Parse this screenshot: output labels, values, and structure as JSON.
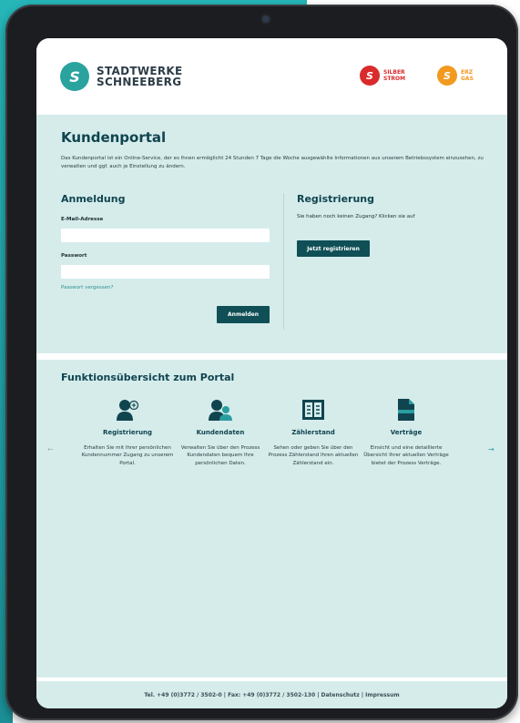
{
  "header": {
    "brand_line1": "STADTWERKE",
    "brand_line2": "SCHNEEBERG",
    "sub_brands": [
      {
        "line1": "SILBER",
        "line2": "STROM",
        "color": "#d92b2b"
      },
      {
        "line1": "ERZ",
        "line2": "GAS",
        "color": "#f29a1f"
      }
    ]
  },
  "portal": {
    "title": "Kundenportal",
    "intro": "Das Kundenportal ist ein Online-Service, der es Ihnen ermöglicht 24 Stunden 7 Tage die Woche ausgewählte Informationen aus unserem Betriebssystem einzusehen, zu verwalten und ggf. auch je Einstellung zu ändern."
  },
  "login": {
    "title": "Anmeldung",
    "email_label": "E-Mail-Adresse",
    "email_value": "",
    "password_label": "Passwort",
    "password_value": "",
    "forgot_link": "Passwort vergessen?",
    "submit_label": "Anmelden"
  },
  "register": {
    "title": "Registrierung",
    "text": "Sie haben noch keinen Zugang? Klicken sie auf",
    "button_label": "Jetzt registrieren"
  },
  "features": {
    "title": "Funktionsübersicht zum Portal",
    "items": [
      {
        "icon": "user-add-icon",
        "name": "Registrierung",
        "desc": "Erhalten Sie mit Ihrer persönlichen Kundennummer Zugang zu unserem Portal."
      },
      {
        "icon": "users-icon",
        "name": "Kundendaten",
        "desc": "Verwalten Sie über den Prozess Kundendaten bequem Ihre persönlichen Daten."
      },
      {
        "icon": "meter-icon",
        "name": "Zählerstand",
        "desc": "Sehen oder geben Sie über den Prozess Zählerstand Ihren aktuellen Zählerstand ein."
      },
      {
        "icon": "document-icon",
        "name": "Verträge",
        "desc": "Einsicht und eine detaillierte Übersicht Ihrer aktuellen Verträge bietet der Prozess Verträge."
      }
    ],
    "prev_arrow": "←",
    "next_arrow": "→"
  },
  "footer": {
    "text": "Tel. +49 (0)3772 / 3502-0 | Fax: +49 (0)3772 / 3502-130 | Datenschutz | Impressum"
  },
  "colors": {
    "accent": "#26b6b8",
    "brand": "#2aa39f",
    "heading": "#10444f",
    "button": "#0f4f55",
    "page_bg": "#d5eceb"
  }
}
